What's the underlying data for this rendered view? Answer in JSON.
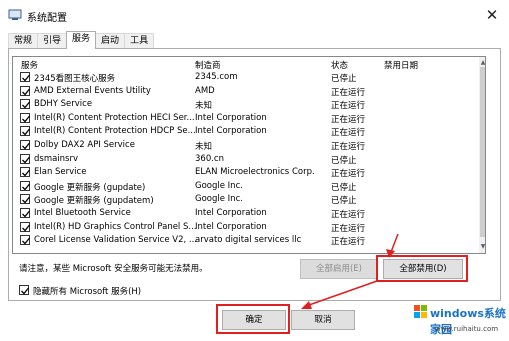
{
  "window": {
    "title": "系统配置",
    "close_glyph": "✕"
  },
  "tabs": [
    "常规",
    "引导",
    "服务",
    "启动",
    "工具"
  ],
  "active_tab": "服务",
  "columns": {
    "service": "服务",
    "manufacturer": "制造商",
    "status": "状态",
    "disabled_date": "禁用日期"
  },
  "services": [
    {
      "name": "2345看图王核心服务",
      "manufacturer": "2345.com",
      "status": "已停止"
    },
    {
      "name": "AMD External Events Utility",
      "manufacturer": "AMD",
      "status": "正在运行"
    },
    {
      "name": "BDHY Service",
      "manufacturer": "未知",
      "status": "正在运行"
    },
    {
      "name": "Intel(R) Content Protection HECI Ser...",
      "manufacturer": "Intel Corporation",
      "status": "正在运行"
    },
    {
      "name": "Intel(R) Content Protection HDCP Se...",
      "manufacturer": "Intel Corporation",
      "status": "正在运行"
    },
    {
      "name": "Dolby DAX2 API Service",
      "manufacturer": "未知",
      "status": "正在运行"
    },
    {
      "name": "dsmainsrv",
      "manufacturer": "360.cn",
      "status": "已停止"
    },
    {
      "name": "Elan Service",
      "manufacturer": "ELAN Microelectronics Corp.",
      "status": "正在运行"
    },
    {
      "name": "Google 更新服务 (gupdate)",
      "manufacturer": "Google Inc.",
      "status": "已停止"
    },
    {
      "name": "Google 更新服务 (gupdatem)",
      "manufacturer": "Google Inc.",
      "status": "已停止"
    },
    {
      "name": "Intel Bluetooth Service",
      "manufacturer": "Intel Corporation",
      "status": "正在运行"
    },
    {
      "name": "Intel(R) HD Graphics Control Panel S...",
      "manufacturer": "Intel Corporation",
      "status": "正在运行"
    },
    {
      "name": "Corel License Validation Service V2, ...",
      "manufacturer": "arvato digital services llc",
      "status": "正在运行"
    }
  ],
  "note": "请注意，某些 Microsoft 安全服务可能无法禁用。",
  "buttons": {
    "enable_all": "全部启用(E)",
    "disable_all": "全部禁用(D)",
    "ok": "确定",
    "cancel": "取消"
  },
  "hide_ms": {
    "label": "隐藏所有 Microsoft 服务(H)",
    "checked": true
  },
  "watermark": {
    "brand": "windows系统家园",
    "url": "www.ruihaitu.com"
  },
  "colors": {
    "highlight": "#e02020",
    "brand": "#1a73c9"
  }
}
